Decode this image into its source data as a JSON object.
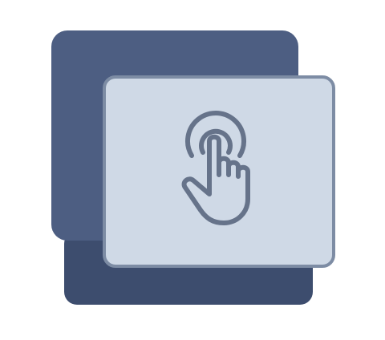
{
  "colors": {
    "background": "#ffffff",
    "back_card": "#4d5e82",
    "back_card_shadow": "#3d4d6e",
    "front_card_fill": "#cfd9e6",
    "front_card_border": "#7d8ca4",
    "icon_stroke": "#66738a"
  },
  "icons": {
    "main": "tap-hand-icon"
  }
}
